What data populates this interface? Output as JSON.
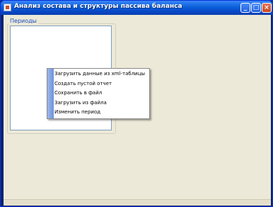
{
  "window": {
    "title": "Анализ состава и структуры пассива баланса",
    "controls": {
      "minimize": "_",
      "maximize": "□",
      "close": "×"
    }
  },
  "periods_group": {
    "label": "Периоды"
  },
  "context_menu": {
    "items": [
      "Загрузить данные из xml-таблицы",
      "Создать пустой отчет",
      "Сохранить в файл",
      "Загрузить из файла",
      "Изменить период"
    ]
  },
  "colors": {
    "titlebar": "#0a5fd8",
    "background": "#ece9d8",
    "close_button": "#c9461f",
    "menu_gutter": "#6d92d8"
  }
}
